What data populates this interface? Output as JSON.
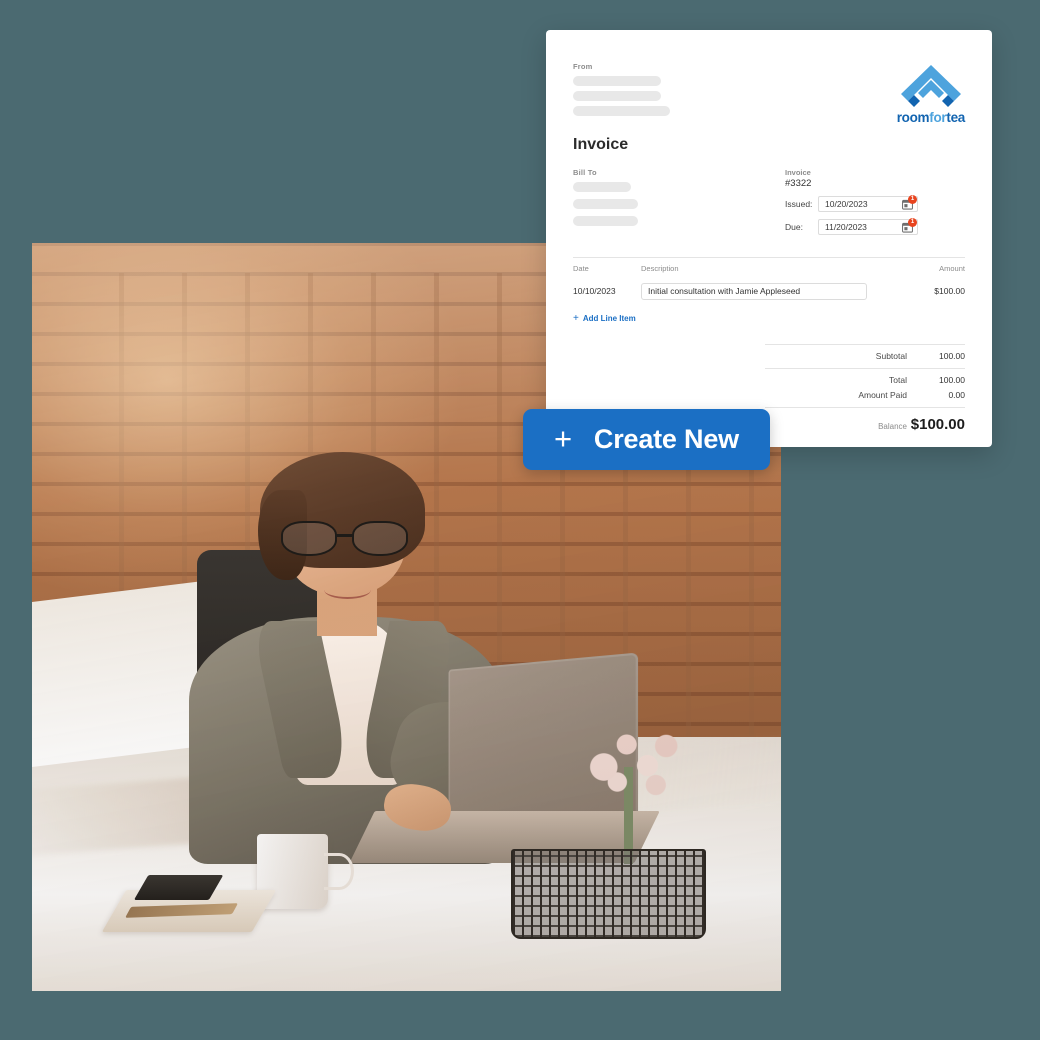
{
  "theme": {
    "background_color": "#4b6a71",
    "accent_blue": "#1b6fc4",
    "logo_dark_blue": "#1264b0",
    "logo_light_blue": "#4da3dd",
    "badge_red": "#e8441f"
  },
  "invoice": {
    "from_label": "From",
    "title": "Invoice",
    "bill_to_label": "Bill To",
    "meta": {
      "invoice_label": "Invoice",
      "invoice_number": "#3322",
      "issued_label": "Issued:",
      "issued_value": "10/20/2023",
      "due_label": "Due:",
      "due_value": "11/20/2023",
      "issued_badge": "1",
      "due_badge": "1"
    },
    "logo": {
      "text_room": "room",
      "text_for": "for",
      "text_tea": "tea",
      "mark": "house-roof-chevron-icon"
    },
    "table": {
      "headers": {
        "date": "Date",
        "description": "Description",
        "amount": "Amount"
      },
      "rows": [
        {
          "date": "10/10/2023",
          "description": "Initial consultation with Jamie Appleseed",
          "amount": "$100.00"
        }
      ],
      "add_line_item": "Add Line Item",
      "add_line_item_icon": "plus-icon"
    },
    "totals": {
      "subtotal_label": "Subtotal",
      "subtotal_value": "100.00",
      "total_label": "Total",
      "total_value": "100.00",
      "amount_paid_label": "Amount Paid",
      "amount_paid_value": "0.00",
      "balance_label": "Balance",
      "balance_value": "$100.00"
    }
  },
  "create_button": {
    "label": "Create New",
    "icon": "plus-icon"
  }
}
